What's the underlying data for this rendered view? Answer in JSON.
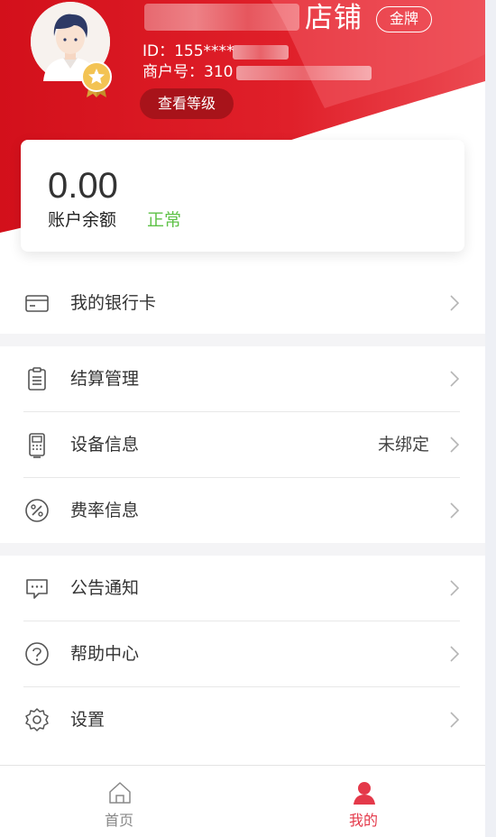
{
  "header": {
    "shop_name_suffix": "店铺",
    "badge": "金牌",
    "id_text": "ID：155****",
    "merchant_text": "商户号：310",
    "level_button": "查看等级"
  },
  "balance": {
    "amount": "0.00",
    "label": "账户余额",
    "status": "正常"
  },
  "menu": {
    "bank_card": "我的银行卡",
    "settlement": "结算管理",
    "device": "设备信息",
    "device_value": "未绑定",
    "rate": "费率信息",
    "notice": "公告通知",
    "help": "帮助中心",
    "settings": "设置"
  },
  "tabbar": {
    "home": "首页",
    "mine": "我的"
  },
  "colors": {
    "brand_red": "#d9141e",
    "active_tab": "#e4394a",
    "status_green": "#5fc248"
  }
}
